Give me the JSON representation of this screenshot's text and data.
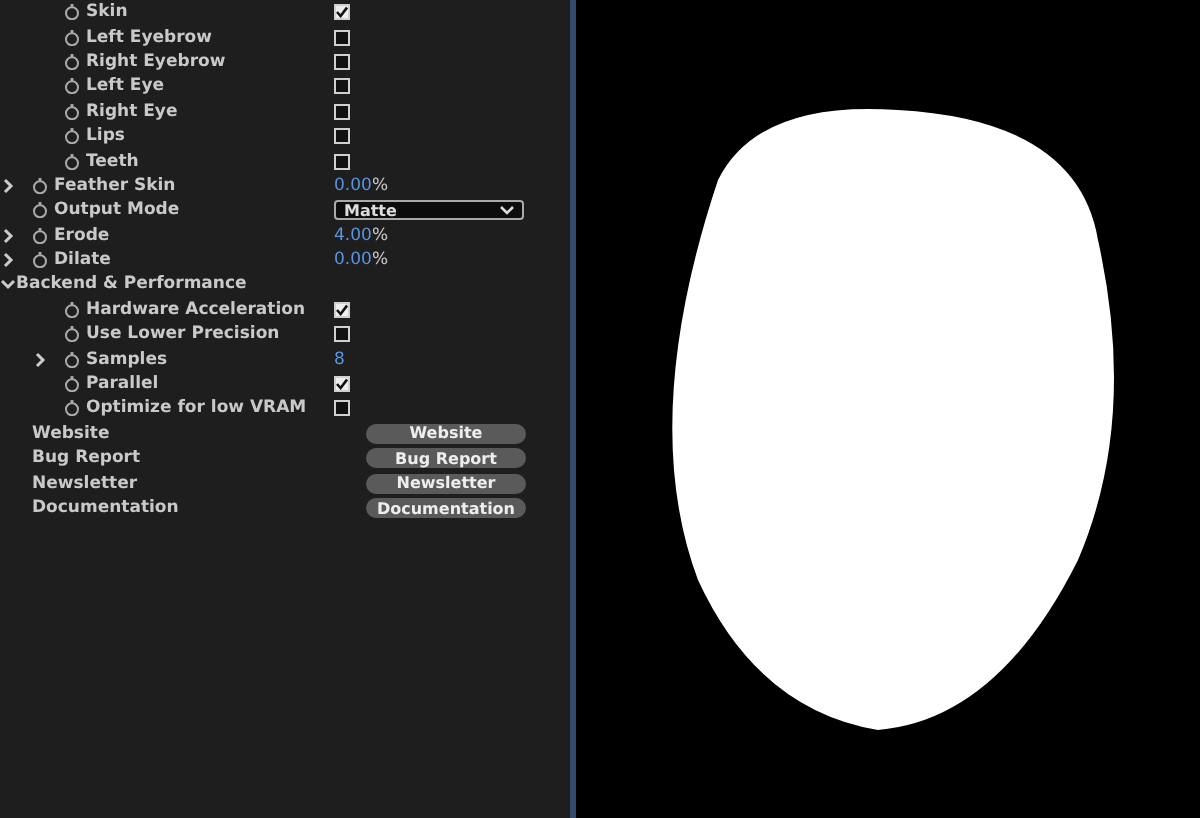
{
  "parts": [
    {
      "label": "Skin",
      "checked": true
    },
    {
      "label": "Left Eyebrow",
      "checked": false
    },
    {
      "label": "Right Eyebrow",
      "checked": false
    },
    {
      "label": "Left Eye",
      "checked": false
    },
    {
      "label": "Right Eye",
      "checked": false
    },
    {
      "label": "Lips",
      "checked": false
    },
    {
      "label": "Teeth",
      "checked": false
    }
  ],
  "settings": [
    {
      "kind": "value",
      "label": "Feather Skin",
      "expanded": false,
      "value": "0.00",
      "unit": "%"
    },
    {
      "kind": "dropdown",
      "label": "Output Mode",
      "value": "Matte"
    },
    {
      "kind": "value",
      "label": "Erode",
      "expanded": false,
      "value": "4.00",
      "unit": "%"
    },
    {
      "kind": "value",
      "label": "Dilate",
      "expanded": false,
      "value": "0.00",
      "unit": "%"
    }
  ],
  "backend": {
    "label": "Backend & Performance",
    "expanded": true,
    "children": [
      {
        "kind": "checkbox",
        "label": "Hardware Acceleration",
        "checked": true
      },
      {
        "kind": "checkbox",
        "label": "Use Lower Precision",
        "checked": false
      },
      {
        "kind": "value",
        "label": "Samples",
        "expanded": false,
        "value": "8"
      },
      {
        "kind": "checkbox",
        "label": "Parallel",
        "checked": true
      },
      {
        "kind": "checkbox",
        "label": "Optimize for low VRAM",
        "checked": false
      }
    ]
  },
  "links": [
    {
      "label": "Website",
      "button": "Website"
    },
    {
      "label": "Bug Report",
      "button": "Bug Report"
    },
    {
      "label": "Newsletter",
      "button": "Newsletter"
    },
    {
      "label": "Documentation",
      "button": "Documentation"
    }
  ]
}
